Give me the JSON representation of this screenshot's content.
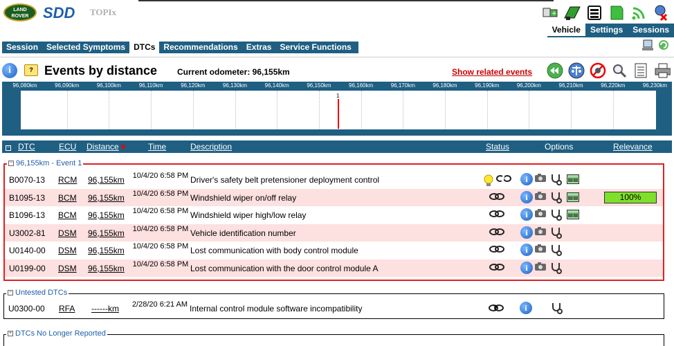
{
  "header": {
    "brand_logo": "LAND ROVER",
    "app_name": "SDD",
    "sub_app": "TOPIx",
    "mode_tabs": [
      {
        "label": "Vehicle",
        "active": true
      },
      {
        "label": "Settings",
        "active": false
      },
      {
        "label": "Sessions",
        "active": false
      }
    ]
  },
  "nav": {
    "items": [
      {
        "label": "Session",
        "active": false
      },
      {
        "label": "Selected Symptoms",
        "active": false
      },
      {
        "label": "DTCs",
        "active": true
      },
      {
        "label": "Recommendations",
        "active": false
      },
      {
        "label": "Extras",
        "active": false
      },
      {
        "label": "Service Functions",
        "active": false
      }
    ]
  },
  "events": {
    "title": "Events by distance",
    "odometer": "Current odometer: 96,155km",
    "related_link": "Show related events"
  },
  "timeline": {
    "ticks": [
      "96,080km",
      "96,090km",
      "96,100km",
      "96,110km",
      "96,120km",
      "96,130km",
      "96,140km",
      "96,150km",
      "96,160km",
      "96,170km",
      "96,180km",
      "96,190km",
      "96,200km",
      "96,210km",
      "96,220km",
      "96,230km"
    ],
    "marker_label": "1"
  },
  "table": {
    "columns": {
      "dtc": "DTC",
      "ecu": "ECU",
      "distance": "Distance",
      "time": "Time",
      "description": "Description",
      "status": "Status",
      "options": "Options",
      "relevance": "Relevance"
    }
  },
  "groups": {
    "event1": {
      "title": "96,155km - Event 1",
      "rows": [
        {
          "dtc": "B0070-13",
          "ecu": "RCM",
          "distance": "96,155km",
          "time": "10/4/20 6:58 PM",
          "description": "Driver's safety belt pretensioner deployment control",
          "relevance": ""
        },
        {
          "dtc": "B1095-13",
          "ecu": "BCM",
          "distance": "96,155km",
          "time": "10/4/20 6:58 PM",
          "description": "Windshield wiper on/off relay",
          "relevance": "100%"
        },
        {
          "dtc": "B1096-13",
          "ecu": "BCM",
          "distance": "96,155km",
          "time": "10/4/20 6:58 PM",
          "description": "Windshield wiper high/low relay",
          "relevance": ""
        },
        {
          "dtc": "U3002-81",
          "ecu": "DSM",
          "distance": "96,155km",
          "time": "10/4/20 6:58 PM",
          "description": "Vehicle identification number",
          "relevance": ""
        },
        {
          "dtc": "U0140-00",
          "ecu": "DSM",
          "distance": "96,155km",
          "time": "10/4/20 6:58 PM",
          "description": "Lost communication with body control module",
          "relevance": ""
        },
        {
          "dtc": "U0199-00",
          "ecu": "DSM",
          "distance": "96,155km",
          "time": "10/4/20 6:58 PM",
          "description": "Lost communication with the door control module A",
          "relevance": ""
        }
      ]
    },
    "untested": {
      "title": "Untested DTCs",
      "rows": [
        {
          "dtc": "U0300-00",
          "ecu": "RFA",
          "distance": "------km",
          "time": "2/28/20 6:21 AM",
          "description": "Internal control module software incompatibility"
        }
      ]
    },
    "no_longer": {
      "title": "DTCs No Longer Reported"
    }
  },
  "colors": {
    "nav_bar": "#1f5f82",
    "event_border": "#e02020",
    "row_highlight": "#fde0e0",
    "relevance_fill": "#7ee02a",
    "timeline_marker": "#ee0000"
  }
}
